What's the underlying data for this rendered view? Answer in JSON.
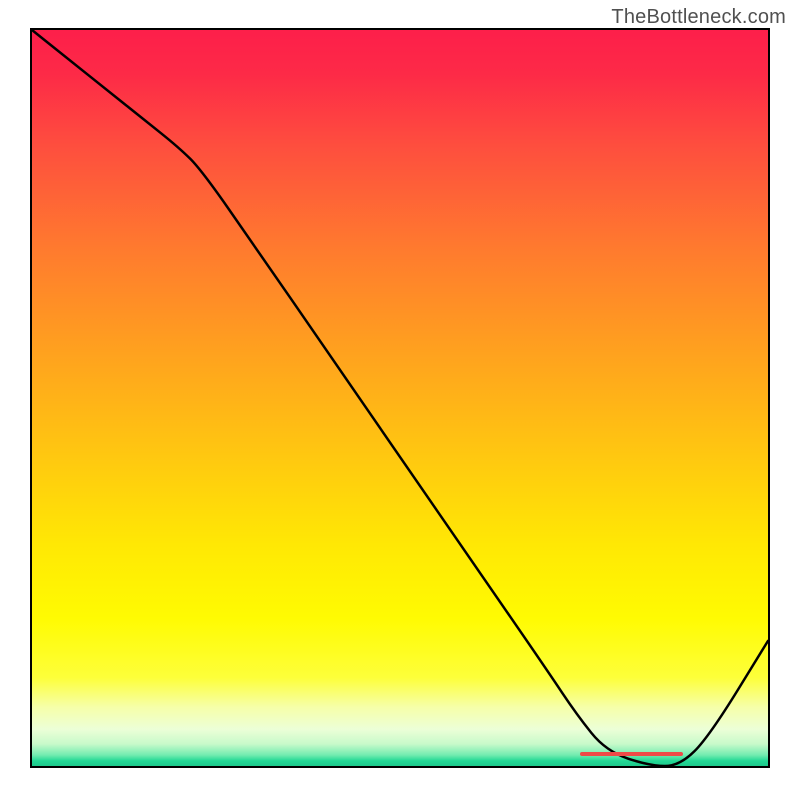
{
  "watermark": "TheBottleneck.com",
  "chart_data": {
    "type": "line",
    "title": "",
    "xlabel": "",
    "ylabel": "",
    "xlim": [
      0,
      100
    ],
    "ylim": [
      0,
      100
    ],
    "grid": false,
    "legend": false,
    "x": [
      0,
      5,
      10,
      15,
      20,
      23,
      30,
      40,
      50,
      60,
      70,
      74,
      78,
      84,
      88,
      92,
      100
    ],
    "values": [
      100,
      96,
      92,
      88,
      84,
      81,
      71,
      56.5,
      42,
      27.5,
      13,
      7,
      2,
      0,
      0,
      4,
      17
    ],
    "plateau": {
      "x_start": 74,
      "x_end": 88,
      "label": "",
      "color": "#ef4a47"
    },
    "gradient": {
      "top_color": "#fd1f4a",
      "mid_color": "#ffe804",
      "bottom_color": "#1dc98b"
    }
  }
}
